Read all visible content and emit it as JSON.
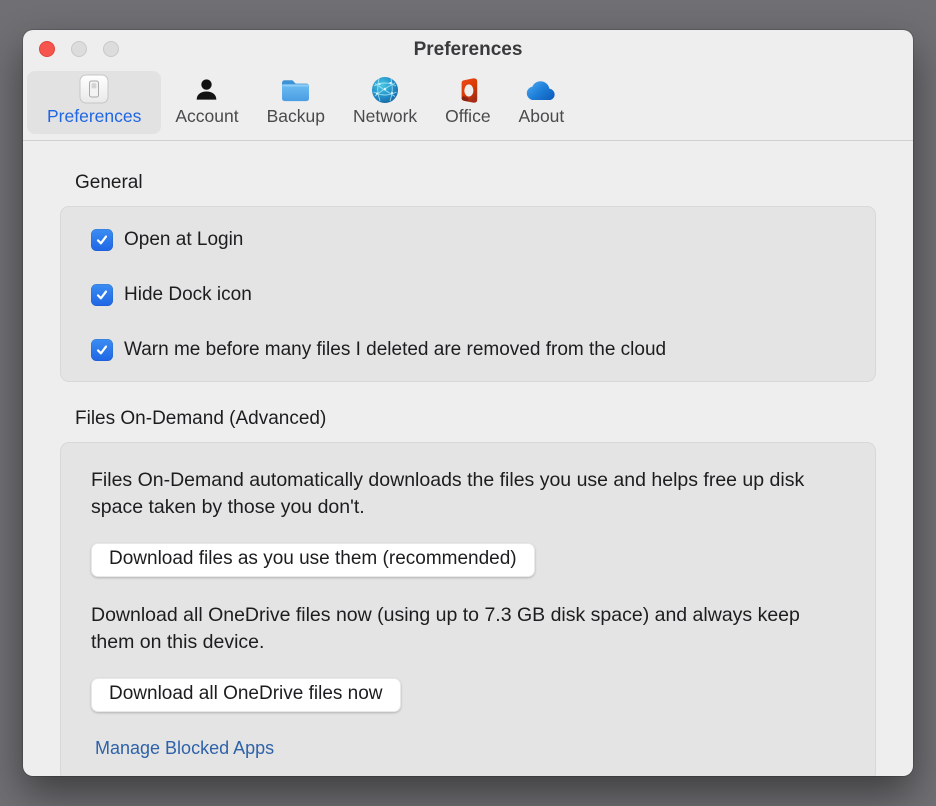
{
  "window": {
    "title": "Preferences",
    "controls": {
      "close": "close",
      "minimize": "minimize",
      "zoom": "zoom"
    }
  },
  "toolbar": {
    "tabs": [
      {
        "label": "Preferences",
        "icon": "light-switch-icon",
        "selected": true
      },
      {
        "label": "Account",
        "icon": "person-icon",
        "selected": false
      },
      {
        "label": "Backup",
        "icon": "folder-icon",
        "selected": false
      },
      {
        "label": "Network",
        "icon": "globe-icon",
        "selected": false
      },
      {
        "label": "Office",
        "icon": "office-logo-icon",
        "selected": false
      },
      {
        "label": "About",
        "icon": "onedrive-cloud-icon",
        "selected": false
      }
    ]
  },
  "general": {
    "heading": "General",
    "checkboxes": [
      {
        "label": "Open at Login",
        "checked": true
      },
      {
        "label": "Hide Dock icon",
        "checked": true
      },
      {
        "label": "Warn me before many files I deleted are removed from the cloud",
        "checked": true
      }
    ]
  },
  "files_on_demand": {
    "heading": "Files On-Demand (Advanced)",
    "description1": "Files On-Demand automatically downloads the files you use and helps free up disk space taken by those you don't.",
    "button1": "Download files as you use them (recommended)",
    "description2": "Download all OneDrive files now (using up to 7.3 GB disk space) and always keep them on this device.",
    "button2": "Download all OneDrive files now",
    "link": "Manage Blocked Apps"
  },
  "colors": {
    "accent_blue": "#1f66e5",
    "checkbox_blue": "#1d6ae5",
    "link_blue": "#2e62a8",
    "close_red": "#f6554e",
    "window_bg": "#efeeee",
    "group_box_bg": "#e5e4e4",
    "desktop_bg": "#707074"
  }
}
